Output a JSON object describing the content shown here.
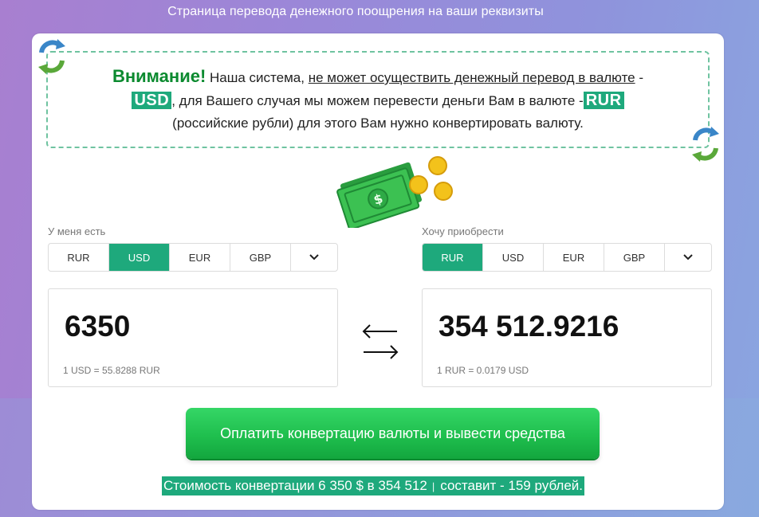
{
  "page": {
    "title": "Страница перевода денежного поощрения на ваши реквизиты"
  },
  "notice": {
    "attention": "Внимание!",
    "part1": " Наша система, ",
    "underlined": "не может осуществить  денежный перевод в валюте",
    "part2": " -",
    "from_currency": "USD",
    "part3": ", для Вашего случая мы можем перевести деньги Вам в валюте -",
    "to_currency": "RUR",
    "part4": "(российские рубли) для этого Вам нужно конвертировать валюту."
  },
  "have": {
    "label": "У меня есть",
    "tabs": [
      "RUR",
      "USD",
      "EUR",
      "GBP"
    ],
    "selected": "USD",
    "amount": "6350",
    "rate": "1 USD = 55.8288 RUR"
  },
  "want": {
    "label": "Хочу приобрести",
    "tabs": [
      "RUR",
      "USD",
      "EUR",
      "GBP"
    ],
    "selected": "RUR",
    "amount": "354 512.9216",
    "rate": "1 RUR = 0.0179 USD"
  },
  "pay_button": {
    "label": "Оплатить конвертацию валюты и вывести средства"
  },
  "cost": {
    "text_before": "Стоимость конвертации 6 350 $ в 354 512 ",
    "glyph": "∣",
    "text_after": " составит - 159 рублей."
  },
  "colors": {
    "accent": "#1ea97c",
    "button": "#1fbf4e",
    "attention": "#0b8a2f"
  },
  "icons": [
    "swap-arrows-icon",
    "money-icon",
    "chevron-down-icon",
    "exchange-arrows-icon"
  ]
}
